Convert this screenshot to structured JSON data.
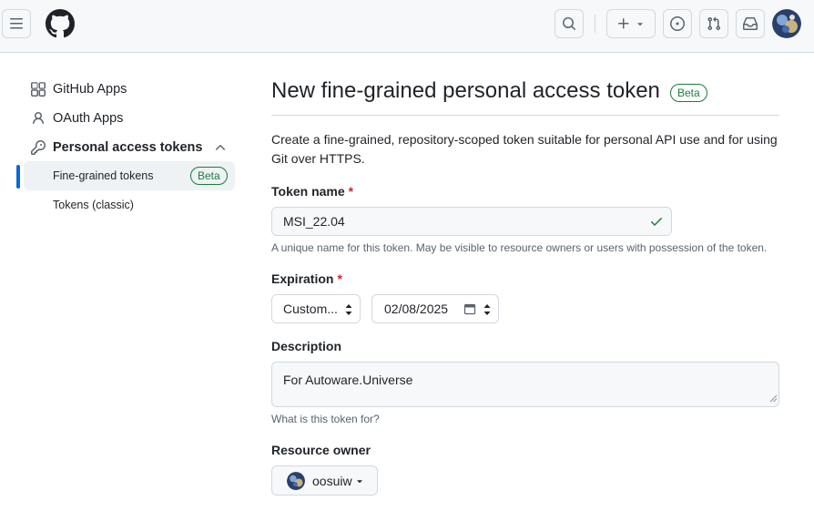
{
  "header": {
    "menu_icon": "hamburger-icon",
    "logo_icon": "github-logo-icon",
    "search_icon": "search-icon",
    "create_icon": "plus-icon",
    "issues_icon": "issue-opened-icon",
    "pulls_icon": "pull-request-icon",
    "inbox_icon": "inbox-icon"
  },
  "sidebar": {
    "items": [
      {
        "label": "GitHub Apps",
        "icon": "apps-icon"
      },
      {
        "label": "OAuth Apps",
        "icon": "person-icon"
      },
      {
        "label": "Personal access tokens",
        "icon": "key-icon"
      }
    ],
    "sub_items": [
      {
        "label": "Fine-grained tokens",
        "badge": "Beta"
      },
      {
        "label": "Tokens (classic)"
      }
    ]
  },
  "main": {
    "title": "New fine-grained personal access token",
    "title_badge": "Beta",
    "intro": "Create a fine-grained, repository-scoped token suitable for personal API use and for using Git over HTTPS.",
    "token_name": {
      "label": "Token name",
      "required_mark": "*",
      "value": "MSI_22.04",
      "note": "A unique name for this token. May be visible to resource owners or users with possession of the token."
    },
    "expiration": {
      "label": "Expiration",
      "required_mark": "*",
      "select_value": "Custom...",
      "date_value": "02/08/2025"
    },
    "description": {
      "label": "Description",
      "value": "For Autoware.Universe",
      "note": "What is this token for?"
    },
    "resource_owner": {
      "label": "Resource owner",
      "value": "oosuiw"
    }
  },
  "colors": {
    "accent": "#0969da",
    "success": "#1a7f37",
    "danger": "#d1242f",
    "border": "#d1d9e0"
  }
}
